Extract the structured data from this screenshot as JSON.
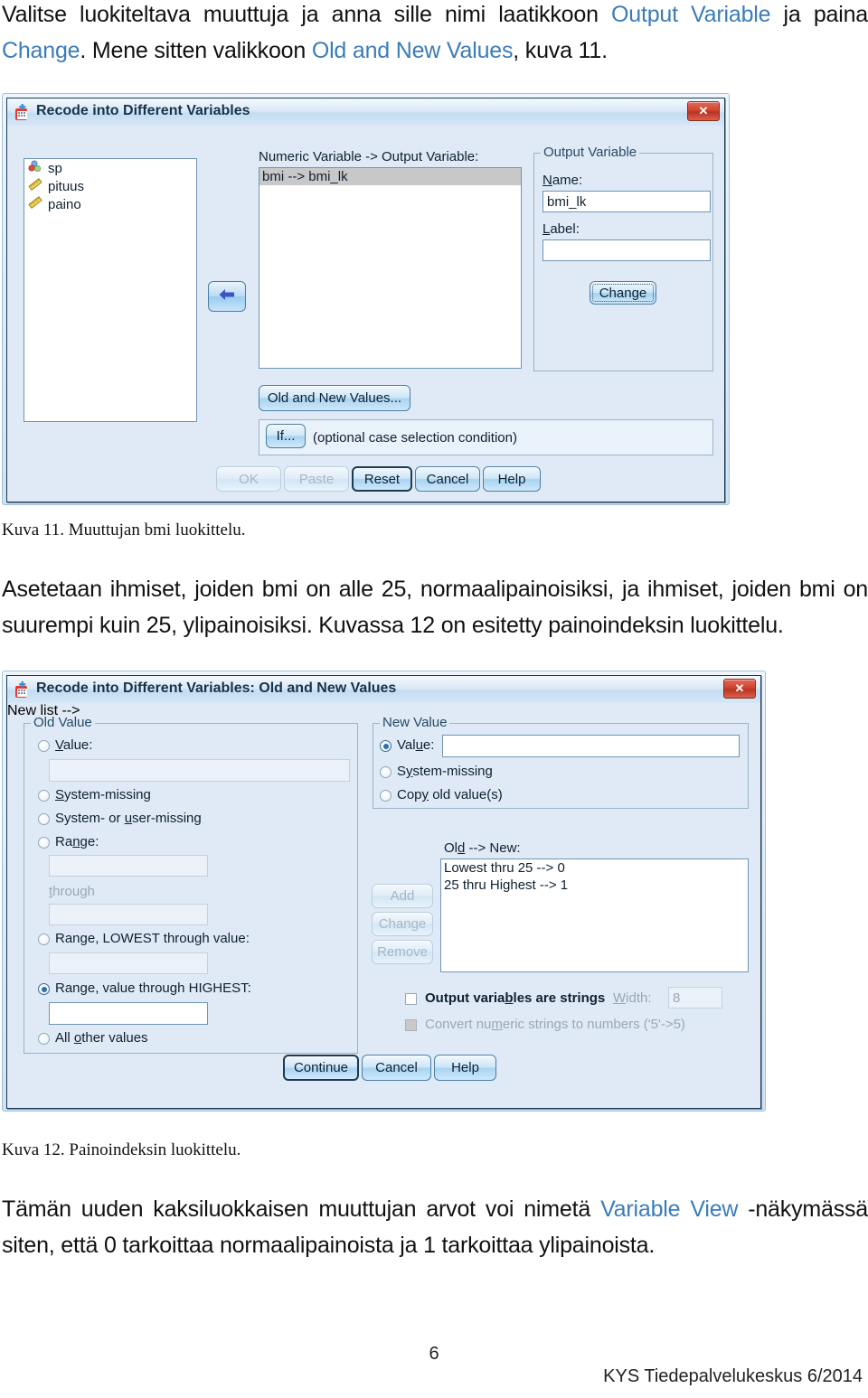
{
  "document": {
    "intro_paragraph": {
      "segments": [
        {
          "text": "Valitse luokiteltava muuttuja ja anna sille nimi laatikkoon ",
          "style": "normal"
        },
        {
          "text": "Output Variable",
          "style": "link"
        },
        {
          "text": " ja paina ",
          "style": "normal"
        },
        {
          "text": "Change",
          "style": "link"
        },
        {
          "text": ". Mene sitten valikkoon ",
          "style": "normal"
        },
        {
          "text": "Old and New Values",
          "style": "link"
        },
        {
          "text": ", kuva 11.",
          "style": "normal"
        }
      ]
    },
    "caption_11": "Kuva 11. Muuttujan bmi luokittelu.",
    "middle_paragraph": "Asetetaan ihmiset, joiden bmi on alle 25, normaalipainoisiksi, ja ihmiset, joiden bmi on suurempi kuin 25, ylipainoisiksi. Kuvassa 12 on esitetty painoindeksin luokittelu.",
    "caption_12": "Kuva 12. Painoindeksin luokittelu.",
    "end_paragraph": {
      "segments": [
        {
          "text": "Tämän uuden kaksiluokkaisen muuttujan arvot voi nimetä ",
          "style": "normal"
        },
        {
          "text": "Variable View",
          "style": "link"
        },
        {
          "text": " -näkymässä siten, että 0 tarkoittaa normaalipainoista ja 1 tarkoittaa ylipainoista.",
          "style": "normal"
        }
      ]
    },
    "page_number": "6",
    "footer_organization": "KYS Tiedepalvelukeskus 6/2014",
    "link_color": "#3b7cb8"
  },
  "dialog_recode": {
    "title": "Recode into Different Variables",
    "close_label": "✕",
    "source_variables": [
      {
        "name": "sp",
        "icon": "nominal-icon"
      },
      {
        "name": "pituus",
        "icon": "scale-icon"
      },
      {
        "name": "paino",
        "icon": "scale-icon"
      }
    ],
    "transfer_arrow": "◄",
    "numeric_variable_label": "Numeric Variable -> Output Variable:",
    "numeric_variable_items": [
      "bmi --> bmi_lk"
    ],
    "output_variable_group": "Output Variable",
    "name_label": "Name:",
    "name_value": "bmi_lk",
    "label_label": "Label:",
    "label_value": "",
    "change_button": "Change",
    "old_and_new_values_button": "Old and New Values...",
    "if_button": "If...",
    "if_hint": "(optional case selection condition)",
    "buttons": [
      {
        "label": "OK",
        "state": "disabled"
      },
      {
        "label": "Paste",
        "state": "disabled"
      },
      {
        "label": "Reset",
        "state": "default"
      },
      {
        "label": "Cancel",
        "state": "enabled"
      },
      {
        "label": "Help",
        "state": "enabled"
      }
    ]
  },
  "dialog_old_new": {
    "title": "Recode into Different Variables: Old and New Values",
    "close_label": "✕",
    "old_value_group": "Old Value",
    "old_value_options": [
      {
        "label": "Value:",
        "selected": false
      },
      {
        "label": "System-missing",
        "selected": false
      },
      {
        "label": "System- or user-missing",
        "selected": false
      },
      {
        "label": "Range:",
        "selected": false
      },
      {
        "label": "Range, LOWEST through value:",
        "selected": false
      },
      {
        "label": "Range, value through HIGHEST:",
        "selected": true
      },
      {
        "label": "All other values",
        "selected": false
      }
    ],
    "through_label": "through",
    "old_value_fields": {
      "value": "",
      "range_from": "",
      "range_to": "",
      "lowest_through": "",
      "through_highest": ""
    },
    "new_value_group": "New Value",
    "new_value_options": [
      {
        "label": "Value:",
        "selected": true
      },
      {
        "label": "System-missing",
        "selected": false
      },
      {
        "label": "Copy old value(s)",
        "selected": false
      }
    ],
    "new_value_field": "",
    "mid_buttons": [
      {
        "label": "Add",
        "state": "disabled"
      },
      {
        "label": "Change",
        "state": "disabled"
      },
      {
        "label": "Remove",
        "state": "disabled"
      }
    ],
    "old_new_label": "Old --> New:",
    "mapping_rows": [
      "Lowest thru 25 --> 0",
      "25 thru Highest --> 1"
    ],
    "output_strings_checkbox": "Output variables are strings",
    "width_label": "Width:",
    "width_value": "8",
    "convert_checkbox": "Convert numeric strings to numbers ('5'->5)",
    "buttons": [
      {
        "label": "Continue",
        "state": "default"
      },
      {
        "label": "Cancel",
        "state": "enabled"
      },
      {
        "label": "Help",
        "state": "enabled"
      }
    ]
  }
}
